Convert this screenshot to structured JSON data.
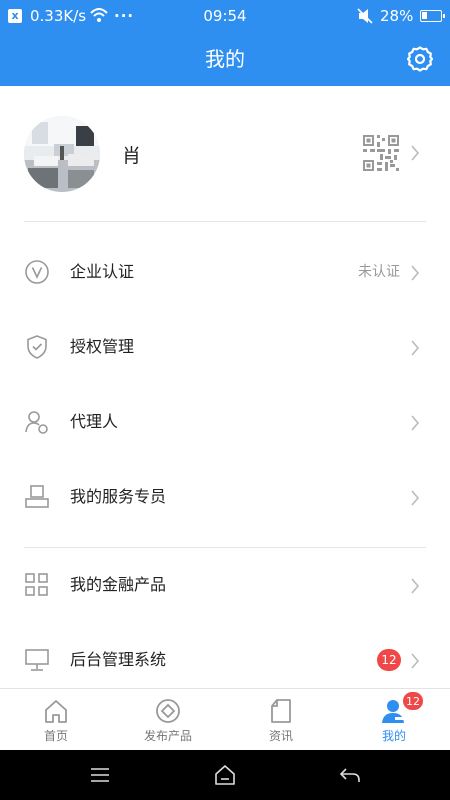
{
  "status_bar": {
    "close_glyph": "x",
    "speed": "0.33K/s",
    "dots": "···",
    "time": "09:54",
    "battery": "28%"
  },
  "header": {
    "title": "我的",
    "settings_icon": "gear-icon"
  },
  "profile": {
    "name": "肖",
    "qr_icon": "qr-code-icon"
  },
  "menu": [
    {
      "label": "企业认证",
      "status": "未认证",
      "icon": "verified-v-icon"
    },
    {
      "label": "授权管理",
      "icon": "shield-check-icon"
    },
    {
      "label": "代理人",
      "icon": "agent-person-icon"
    },
    {
      "label": "我的服务专员",
      "icon": "service-person-icon"
    },
    {
      "label": "我的金融产品",
      "icon": "grid-icon"
    },
    {
      "label": "后台管理系统",
      "badge": "12",
      "icon": "monitor-icon"
    }
  ],
  "tabs": [
    {
      "label": "首页",
      "icon": "home-icon"
    },
    {
      "label": "发布产品",
      "icon": "publish-icon"
    },
    {
      "label": "资讯",
      "icon": "news-icon"
    },
    {
      "label": "我的",
      "icon": "user-icon",
      "badge": "12",
      "active": true
    }
  ],
  "colors": {
    "primary": "#2e8ff0",
    "badge": "#f04848",
    "icon_gray": "#999999"
  }
}
